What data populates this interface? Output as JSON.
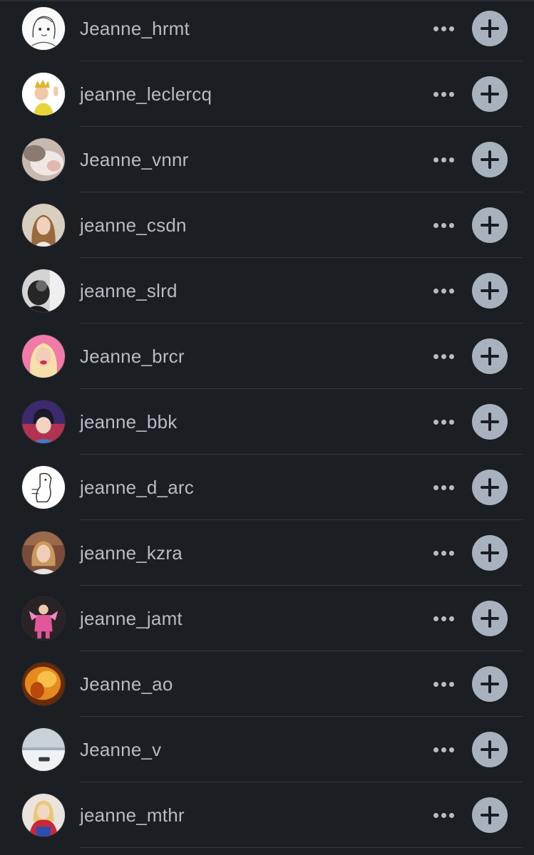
{
  "users": [
    {
      "username": "Jeanne_hrmt",
      "avatar": "sketch-girl-avatar"
    },
    {
      "username": "jeanne_leclercq",
      "avatar": "crowned-memoji-avatar"
    },
    {
      "username": "Jeanne_vnnr",
      "avatar": "blurry-photo-avatar"
    },
    {
      "username": "jeanne_csdn",
      "avatar": "selfie-photo-avatar"
    },
    {
      "username": "jeanne_slrd",
      "avatar": "bw-photo-avatar"
    },
    {
      "username": "Jeanne_brcr",
      "avatar": "pink-portrait-avatar"
    },
    {
      "username": "jeanne_bbk",
      "avatar": "illustrated-avatar"
    },
    {
      "username": "jeanne_d_arc",
      "avatar": "doodle-avatar"
    },
    {
      "username": "jeanne_kzra",
      "avatar": "portrait-photo-avatar"
    },
    {
      "username": "jeanne_jamt",
      "avatar": "child-pink-outfit-avatar"
    },
    {
      "username": "Jeanne_ao",
      "avatar": "orange-hair-avatar"
    },
    {
      "username": "Jeanne_v",
      "avatar": "snowy-landscape-avatar"
    },
    {
      "username": "jeanne_mthr",
      "avatar": "spiderman-plush-avatar"
    }
  ],
  "colors": {
    "background": "#1b1e23",
    "text": "#b6bcc5",
    "add_button": "#a8b2bf",
    "divider": "#32363d"
  },
  "icons": {
    "more": "ellipsis-icon",
    "add": "plus-icon"
  }
}
